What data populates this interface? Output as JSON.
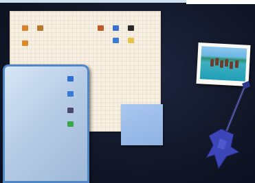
{
  "scene": {
    "description_colors": {
      "board": "#131a2c",
      "window_back": "#f7efe1",
      "window_front_border": "#4f86c6",
      "window_front_fill": "#b8cde6",
      "sticky_note": "#9bbbe9",
      "guitar": "#3d46b8"
    }
  },
  "window_back": {
    "icons": [
      {
        "name": "folder-icon",
        "label": "",
        "color": "#d8822b"
      },
      {
        "name": "folder-icon",
        "label": "",
        "color": "#b8782e"
      },
      {
        "name": "folder-icon",
        "label": "",
        "color": "#e0892a"
      },
      {
        "name": "app-icon",
        "label": "",
        "color": "#c05a2a"
      },
      {
        "name": "app-icon",
        "label": "",
        "color": "#3b6fcf"
      },
      {
        "name": "app-icon",
        "label": "",
        "color": "#2a2a2a"
      },
      {
        "name": "app-icon",
        "label": "",
        "color": "#3a7bd5"
      },
      {
        "name": "folder-icon",
        "label": "",
        "color": "#e8c34a"
      }
    ]
  },
  "window_front": {
    "icons": [
      {
        "name": "app-icon",
        "label": "",
        "color": "#2f6fd1"
      },
      {
        "name": "app-icon",
        "label": "",
        "color": "#3a7bd5"
      },
      {
        "name": "app-icon",
        "label": "",
        "color": "#4a4a70"
      },
      {
        "name": "app-icon",
        "label": "",
        "color": "#3aa84a"
      }
    ]
  }
}
